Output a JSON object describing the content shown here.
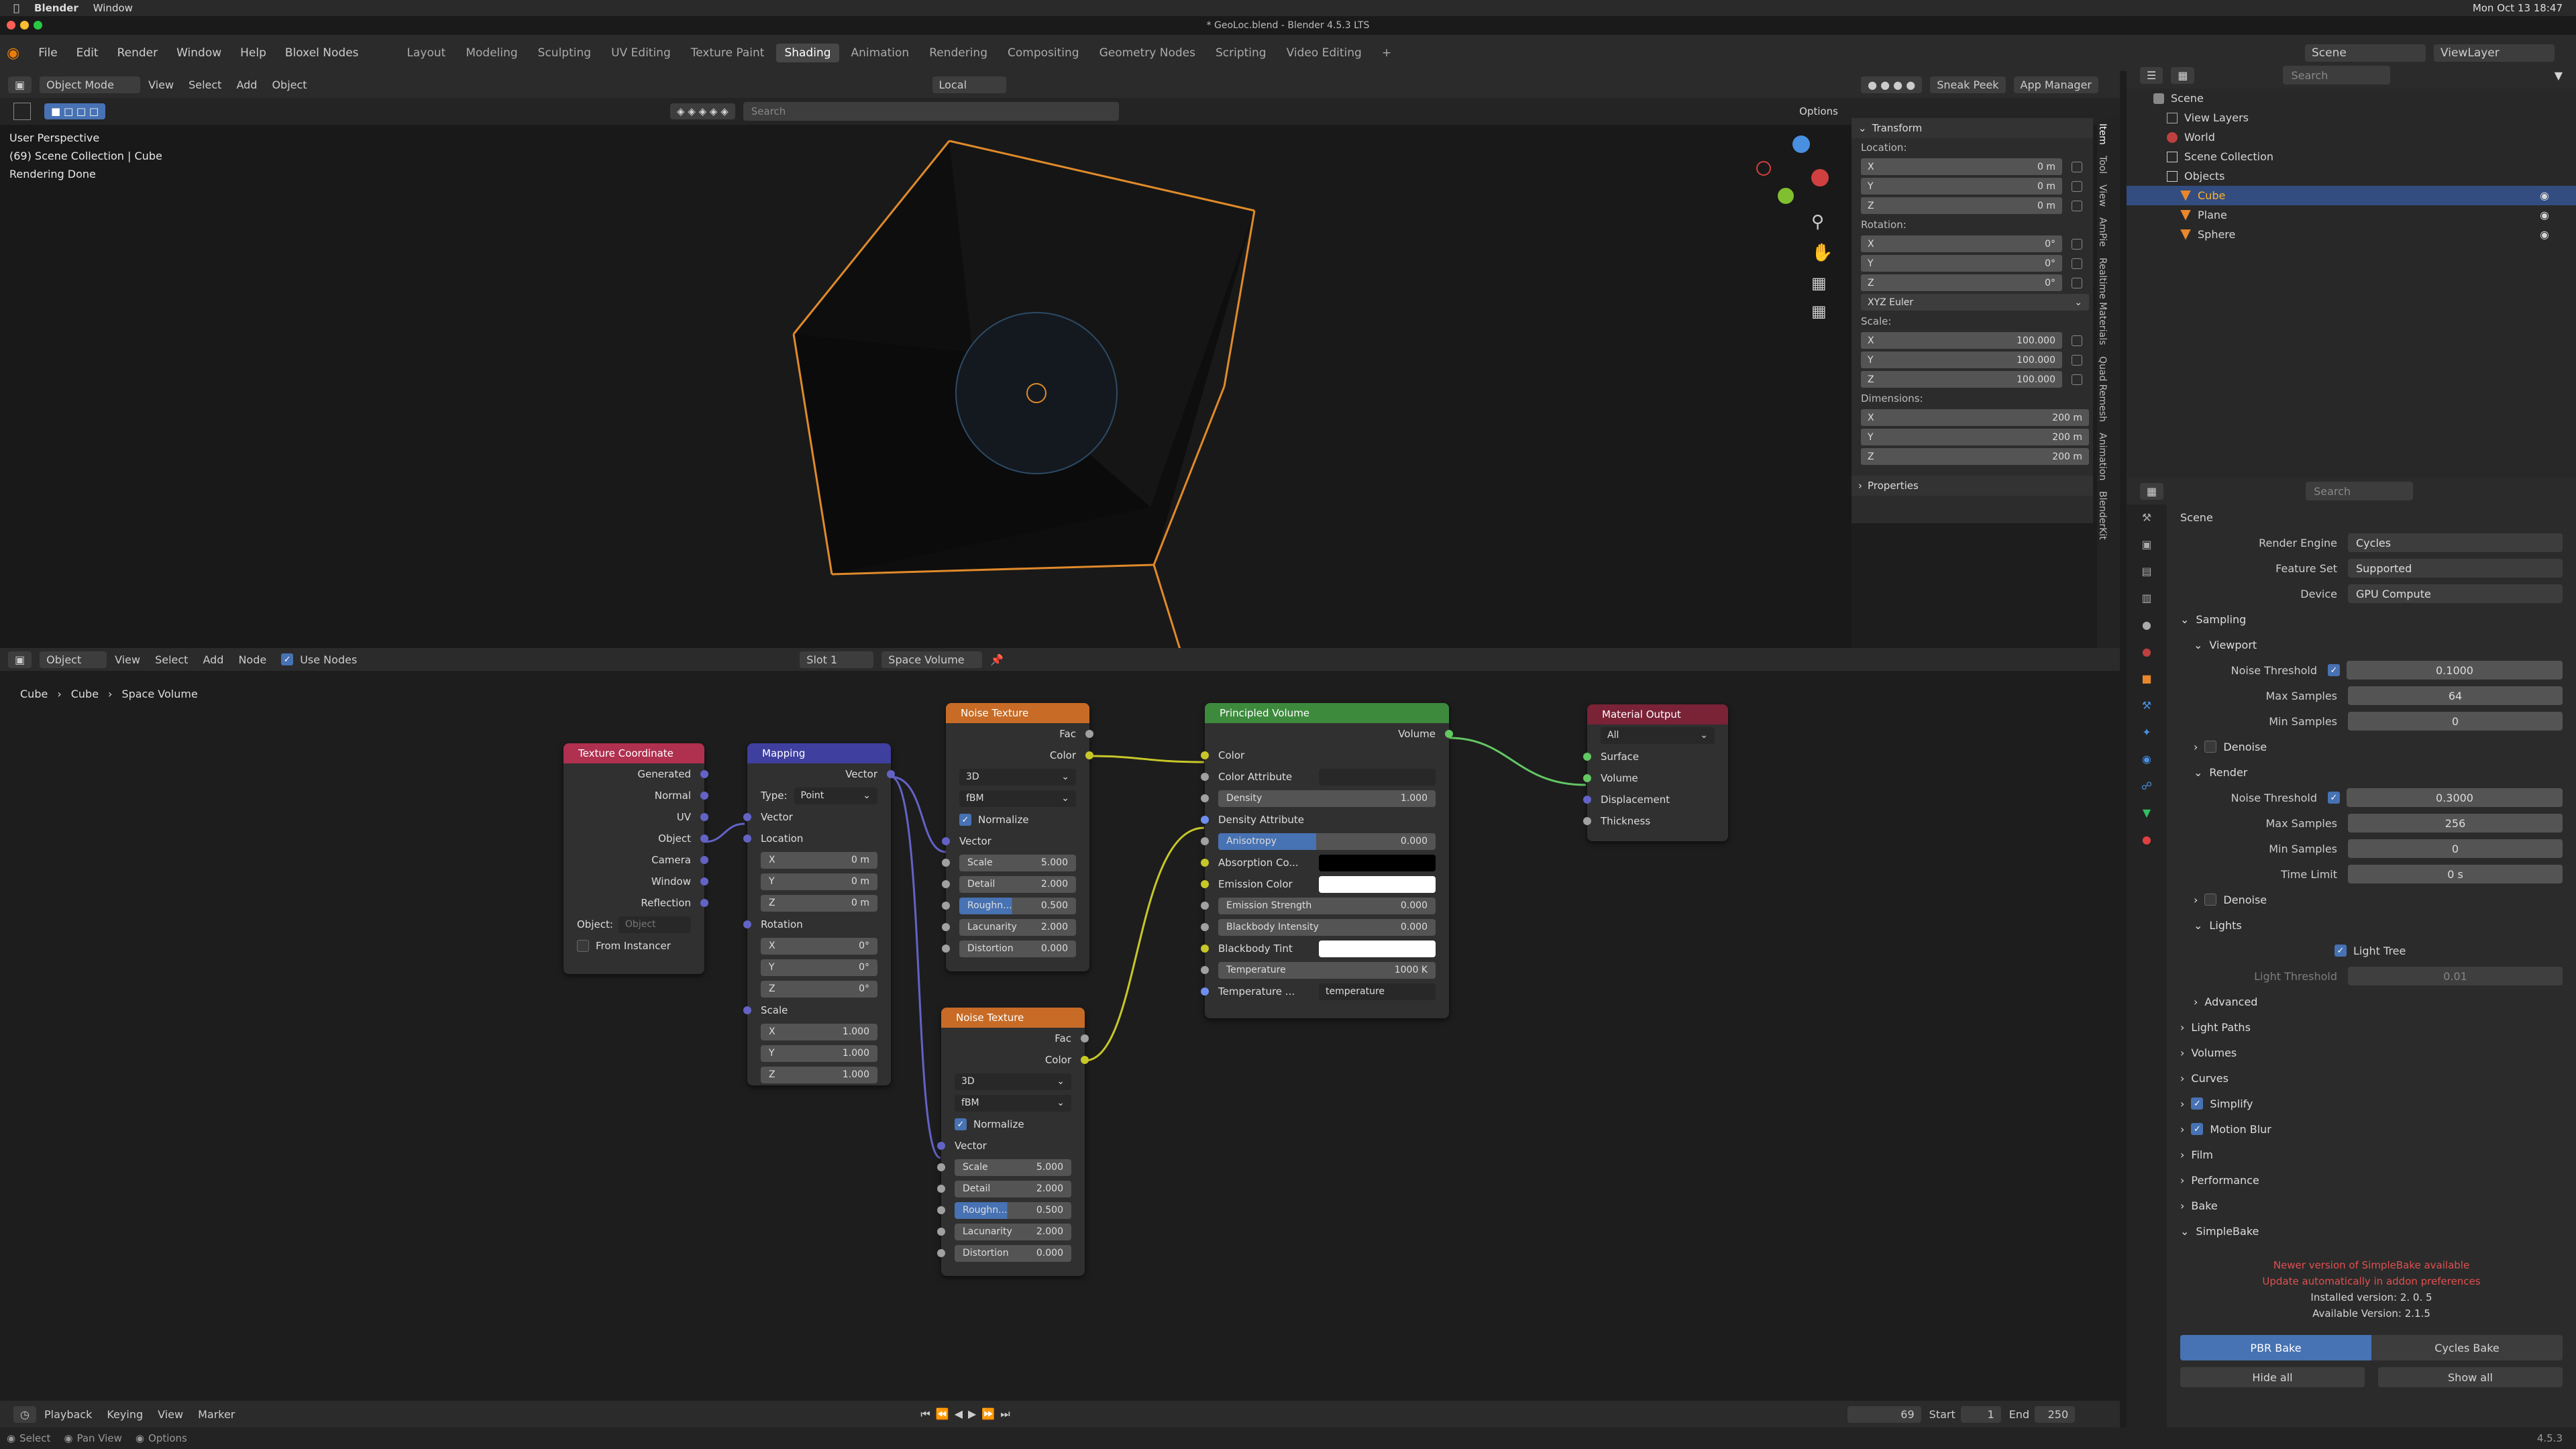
{
  "mac": {
    "app": "Blender",
    "menu": "Window",
    "clock": "Mon Oct 13  18:47"
  },
  "title": "* GeoLoc.blend - Blender 4.5.3 LTS",
  "menu": [
    "File",
    "Edit",
    "Render",
    "Window",
    "Help",
    "Bloxel Nodes"
  ],
  "workspaces": [
    "Layout",
    "Modeling",
    "Sculpting",
    "UV Editing",
    "Texture Paint",
    "Shading",
    "Animation",
    "Rendering",
    "Compositing",
    "Geometry Nodes",
    "Scripting",
    "Video Editing"
  ],
  "active_workspace": "Shading",
  "scene": "Scene",
  "viewlayer": "ViewLayer",
  "vp": {
    "mode": "Object Mode",
    "view": "View",
    "select": "Select",
    "add": "Add",
    "object": "Object",
    "orient": "Local",
    "sneak": "Sneak Peek",
    "appman": "App Manager",
    "search_ph": "Search",
    "options": "Options",
    "info1": "User Perspective",
    "info2": "(69) Scene Collection | Cube",
    "info3": "Rendering Done"
  },
  "npanel": {
    "transform": "Transform",
    "location": "Location:",
    "rotation": "Rotation:",
    "scale": "Scale:",
    "dimensions": "Dimensions:",
    "properties": "Properties",
    "euler": "XYZ Euler",
    "loc": [
      "0 m",
      "0 m",
      "0 m"
    ],
    "rot": [
      "0°",
      "0°",
      "0°"
    ],
    "scl": [
      "100.000",
      "100.000",
      "100.000"
    ],
    "dim": [
      "200 m",
      "200 m",
      "200 m"
    ]
  },
  "vtabs": [
    "Item",
    "Tool",
    "View",
    "AmPie",
    "Realtime Materials",
    "Quad Remesh",
    "Animation",
    "BlenderKit"
  ],
  "outliner": {
    "search_ph": "Search",
    "items": [
      "Scene",
      "View Layers",
      "World",
      "Scene Collection",
      "Objects",
      "Cube",
      "Plane",
      "Sphere"
    ]
  },
  "props": {
    "search_ph": "Search",
    "scene": "Scene",
    "render_engine_l": "Render Engine",
    "render_engine": "Cycles",
    "feature_set_l": "Feature Set",
    "feature_set": "Supported",
    "device_l": "Device",
    "device": "GPU Compute",
    "sampling": "Sampling",
    "viewport": "Viewport",
    "noise_l": "Noise Threshold",
    "vp_noise": "0.1000",
    "max_l": "Max Samples",
    "vp_max": "64",
    "min_l": "Min Samples",
    "vp_min": "0",
    "denoise": "Denoise",
    "render": "Render",
    "r_noise": "0.3000",
    "r_max": "256",
    "r_min": "0",
    "time_l": "Time Limit",
    "r_time": "0 s",
    "lights": "Lights",
    "light_tree": "Light Tree",
    "light_thresh_l": "Light Threshold",
    "light_thresh": "0.01",
    "advanced": "Advanced",
    "sections": [
      "Light Paths",
      "Volumes",
      "Curves",
      "Simplify",
      "Motion Blur",
      "Film",
      "Performance",
      "Bake",
      "SimpleBake"
    ],
    "sb_warn1": "Newer version of SimpleBake available",
    "sb_warn2": "Update automatically in addon preferences",
    "sb_inst": "Installed version: 2. 0. 5",
    "sb_avail": "Available Version: 2.1.5",
    "pbr": "PBR Bake",
    "cycles": "Cycles Bake",
    "hide": "Hide all",
    "show": "Show all"
  },
  "ne": {
    "object": "Object",
    "view": "View",
    "select": "Select",
    "add": "Add",
    "node": "Node",
    "use_nodes": "Use Nodes",
    "slot": "Slot 1",
    "material": "Space Volume",
    "bc1": "Cube",
    "bc2": "Cube",
    "bc3": "Space Volume"
  },
  "nodes": {
    "texcoord": {
      "title": "Texture Coordinate",
      "outs": [
        "Generated",
        "Normal",
        "UV",
        "Object",
        "Camera",
        "Window",
        "Reflection"
      ],
      "object_l": "Object:",
      "object_ph": "Object",
      "from_inst": "From Instancer"
    },
    "mapping": {
      "title": "Mapping",
      "vector": "Vector",
      "type_l": "Type:",
      "type": "Point",
      "vec_in": "Vector",
      "location": "Location",
      "rotation": "Rotation",
      "scale": "Scale",
      "loc": [
        "0 m",
        "0 m",
        "0 m"
      ],
      "rot": [
        "0°",
        "0°",
        "0°"
      ],
      "scl": [
        "1.000",
        "1.000",
        "1.000"
      ]
    },
    "noise1": {
      "title": "Noise Texture",
      "fac": "Fac",
      "color": "Color",
      "dim": "3D",
      "type": "fBM",
      "normalize": "Normalize",
      "vector": "Vector",
      "scale_l": "Scale",
      "scale": "5.000",
      "detail_l": "Detail",
      "detail": "2.000",
      "rough_l": "Roughn...",
      "rough": "0.500",
      "lac_l": "Lacunarity",
      "lac": "2.000",
      "dist_l": "Distortion",
      "dist": "0.000"
    },
    "noise2": {
      "title": "Noise Texture",
      "fac": "Fac",
      "color": "Color",
      "dim": "3D",
      "type": "fBM",
      "normalize": "Normalize",
      "vector": "Vector",
      "scale_l": "Scale",
      "scale": "5.000",
      "detail_l": "Detail",
      "detail": "2.000",
      "rough_l": "Roughn...",
      "rough": "0.500",
      "lac_l": "Lacunarity",
      "lac": "2.000",
      "dist_l": "Distortion",
      "dist": "0.000"
    },
    "pvol": {
      "title": "Principled Volume",
      "volume": "Volume",
      "color": "Color",
      "color_attr": "Color Attribute",
      "density_l": "Density",
      "density": "1.000",
      "density_attr": "Density Attribute",
      "aniso_l": "Anisotropy",
      "aniso": "0.000",
      "absorb": "Absorption Co...",
      "emis_col": "Emission Color",
      "emis_str_l": "Emission Strength",
      "emis_str": "0.000",
      "bb_int_l": "Blackbody Intensity",
      "bb_int": "0.000",
      "bb_tint": "Blackbody Tint",
      "temp_l": "Temperature",
      "temp": "1000 K",
      "temp_attr_l": "Temperature ...",
      "temp_attr": "temperature"
    },
    "matout": {
      "title": "Material Output",
      "target": "All",
      "surface": "Surface",
      "volume": "Volume",
      "displacement": "Displacement",
      "thickness": "Thickness"
    }
  },
  "timeline": {
    "playback": "Playback",
    "keying": "Keying",
    "view": "View",
    "marker": "Marker",
    "frame": "69",
    "start_l": "Start",
    "start": "1",
    "end_l": "End",
    "end": "250"
  },
  "status": {
    "select": "Select",
    "pan": "Pan View",
    "options": "Options",
    "version": "4.5.3"
  },
  "colors": {
    "accent": "#4772b3",
    "selection": "#334d80",
    "cube_outline": "#e08a2a",
    "node_texture": "#c76b26",
    "node_shader": "#3d8a3d",
    "node_output": "#7a2236",
    "node_vector": "#3f3fa0",
    "node_input": "#b0304f"
  }
}
